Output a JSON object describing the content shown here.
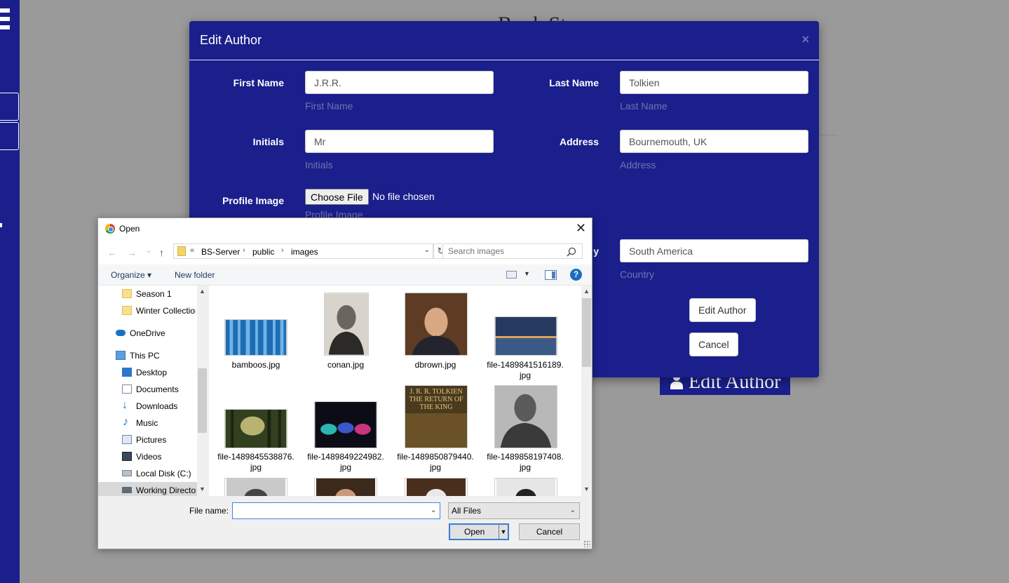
{
  "background_page": {
    "title_partial": "Book St",
    "edit_author_button": "Edit Author"
  },
  "modal": {
    "title": "Edit Author",
    "close": "×",
    "first_name": {
      "label": "First Name",
      "value": "J.R.R.",
      "help": "First Name"
    },
    "last_name": {
      "label": "Last Name",
      "value": "Tolkien",
      "help": "Last Name"
    },
    "initials": {
      "label": "Initials",
      "value": "Mr",
      "help": "Initials"
    },
    "address": {
      "label": "Address",
      "value": "Bournemouth, UK",
      "help": "Address"
    },
    "profile_image": {
      "label": "Profile Image",
      "button": "Choose File",
      "status": "No file chosen",
      "help": "Profile Image"
    },
    "country": {
      "label_partial": "y",
      "value": "South America",
      "help": "Country"
    },
    "submit_button": "Edit Author",
    "cancel_button": "Cancel"
  },
  "dialog": {
    "title": "Open",
    "close": "✕",
    "nav": {
      "back": "←",
      "forward": "→",
      "recent": "⌄",
      "up": "↑",
      "refresh": "↻"
    },
    "address": {
      "prefix": "«",
      "segments": [
        "BS-Server",
        "public",
        "images"
      ],
      "separator": "›"
    },
    "search_placeholder": "Search images",
    "toolbar": {
      "organize": "Organize ▾",
      "new_folder": "New folder",
      "help": "?"
    },
    "tree": [
      {
        "label": "Season 1",
        "icon": "folder-icon"
      },
      {
        "label": "Winter Collection",
        "icon": "folder-icon"
      },
      {
        "label": "OneDrive",
        "icon": "onedrive-icon"
      },
      {
        "label": "This PC",
        "icon": "pc-icon"
      },
      {
        "label": "Desktop",
        "icon": "desktop-icon"
      },
      {
        "label": "Documents",
        "icon": "documents-icon"
      },
      {
        "label": "Downloads",
        "icon": "downloads-icon"
      },
      {
        "label": "Music",
        "icon": "music-icon"
      },
      {
        "label": "Pictures",
        "icon": "pictures-icon"
      },
      {
        "label": "Videos",
        "icon": "videos-icon"
      },
      {
        "label": "Local Disk (C:)",
        "icon": "disk-icon"
      },
      {
        "label": "Working Directory",
        "icon": "network-drive-icon"
      }
    ],
    "files": [
      {
        "name": "bamboos.jpg"
      },
      {
        "name": "conan.jpg"
      },
      {
        "name": "dbrown.jpg"
      },
      {
        "name": "file-1489841516189.jpg"
      },
      {
        "name": "file-1489845538876.jpg"
      },
      {
        "name": "file-1489849224982.jpg"
      },
      {
        "name": "file-1489850879440.jpg"
      },
      {
        "name": "file-1489858197408.jpg"
      }
    ],
    "thumbnail_text": "J. R. R. TOLKIEN THE RETURN OF THE KING",
    "file_name_label": "File name:",
    "file_name_value": "",
    "file_type": "All Files",
    "open_button": "Open",
    "cancel_button": "Cancel",
    "colors": {
      "modal_bg": "#1a1f8c",
      "dialog_bg": "#f0f0f0",
      "accent": "#3a7ed2"
    }
  }
}
